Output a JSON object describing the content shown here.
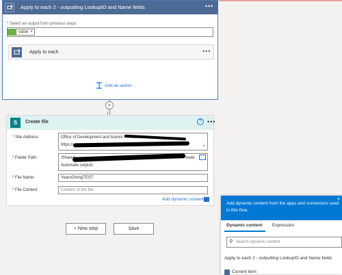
{
  "apply_each_2": {
    "title": "Apply to each 2 - outputting LookupID and Name fields",
    "more": "•••",
    "select_label_req": "*",
    "select_label": "Select an output from previous steps",
    "token_value": "value",
    "token_close": "×",
    "inner_title": "Apply to each",
    "inner_more": "•••",
    "add_action": "Add an action"
  },
  "connector": {
    "plus": "+",
    "arrow": "↓"
  },
  "create_file": {
    "title": "Create file",
    "help": "?",
    "more": "•••",
    "site_label": "Site Address",
    "site_line1": "Office of Development and Alumni Relations -",
    "site_line2": "https://",
    "folder_label": "Folder Path",
    "folder_line1": "/Shared",
    "folder_line1_end": "Power",
    "folder_line2": "Automate outputs",
    "name_label": "File Name",
    "name_value": "YearsGivingTEST",
    "content_label": "File Content",
    "content_placeholder": "Content of the file.",
    "required_mark": "*",
    "add_dynamic": "Add dynamic content"
  },
  "buttons": {
    "new_step": "+ New step",
    "save": "Save"
  },
  "dynamic_panel": {
    "header": "Add dynamic content from the apps and connectors used in this flow.",
    "close": "×",
    "tab_dynamic": "Dynamic content",
    "tab_expression": "Expression",
    "search_placeholder": "Search dynamic content",
    "section": "Apply to each 2 - outputting LookupID and Name fields",
    "item": "Current item"
  },
  "colors": {
    "loop_header": "#4d6a94",
    "sharepoint": "#038387",
    "accent": "#0078d4",
    "link": "#1f6fd1"
  },
  "icons": {
    "loop": "loop-icon",
    "sharepoint": "sharepoint-icon",
    "add_action": "add-action-icon",
    "folder": "folder-icon",
    "search": "search-icon"
  }
}
